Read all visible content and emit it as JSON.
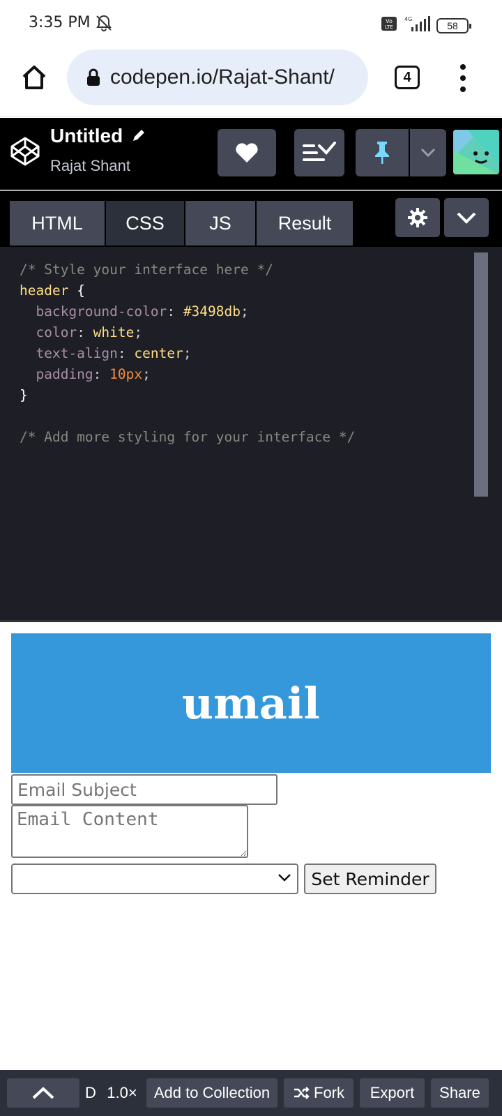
{
  "status_bar": {
    "time": "3:35 PM",
    "battery": "58",
    "network_label": "4G"
  },
  "browser": {
    "url": "codepen.io/Rajat-Shant/",
    "tab_count": "4"
  },
  "pen": {
    "title": "Untitled",
    "author": "Rajat Shant"
  },
  "editor_tabs": [
    "HTML",
    "CSS",
    "JS",
    "Result"
  ],
  "css_code": {
    "comment1": "/* Style your interface here */",
    "selector": "header",
    "props": [
      {
        "name": "background-color",
        "value": "#3498db"
      },
      {
        "name": "color",
        "value": "white"
      },
      {
        "name": "text-align",
        "value": "center"
      },
      {
        "name": "padding",
        "value": "10px"
      }
    ],
    "comment2": "/* Add more styling for your interface */"
  },
  "preview": {
    "heading": "umail",
    "subject_placeholder": "Email Subject",
    "content_placeholder": "Email Content",
    "reminder_button": "Set Reminder",
    "select_value": ""
  },
  "bottom_bar": {
    "d_label": "D",
    "zoom": "1.0×",
    "add_collection": "Add to Collection",
    "fork": "Fork",
    "export": "Export",
    "share": "Share"
  },
  "colors": {
    "header_blue": "#3498db",
    "codepen_gray": "#444857",
    "editor_bg": "#1e1f26"
  }
}
